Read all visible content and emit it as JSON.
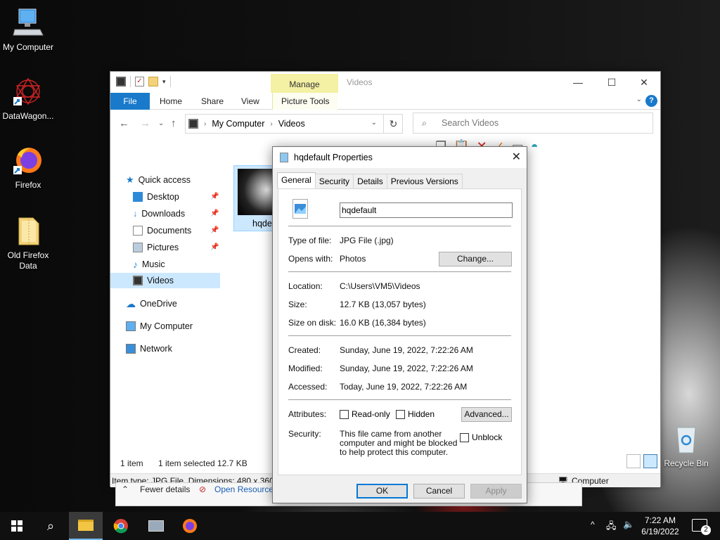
{
  "desktop": {
    "icons": [
      {
        "label": "My Computer"
      },
      {
        "label": "DataWagon..."
      },
      {
        "label": "Firefox"
      },
      {
        "label": "Old Firefox Data"
      },
      {
        "label": "Recycle Bin"
      }
    ]
  },
  "explorer": {
    "title": "Videos",
    "manage_tab": "Manage",
    "ribbon_tabs": [
      "File",
      "Home",
      "Share",
      "View",
      "Picture Tools"
    ],
    "address": {
      "root": "My Computer",
      "current": "Videos"
    },
    "search_placeholder": "Search Videos",
    "nav": {
      "quick_access": "Quick access",
      "items": [
        "Desktop",
        "Downloads",
        "Documents",
        "Pictures",
        "Music",
        "Videos"
      ],
      "onedrive": "OneDrive",
      "my_computer": "My Computer",
      "network": "Network"
    },
    "file_item": {
      "name": "hqdef"
    },
    "status": {
      "count": "1 item",
      "selected": "1 item selected",
      "size": "12.7 KB"
    },
    "details_bar": "Item type: JPG File, Dimensions: 480 x 360, S",
    "computer_label": "Computer",
    "behind": {
      "fewer": "Fewer details",
      "open": "Open Resource"
    }
  },
  "dialog": {
    "title": "hqdefault Properties",
    "tabs": [
      "General",
      "Security",
      "Details",
      "Previous Versions"
    ],
    "filename": "hqdefault",
    "type_label": "Type of file:",
    "type_value": "JPG File (.jpg)",
    "opens_label": "Opens with:",
    "opens_value": "Photos",
    "change_btn": "Change...",
    "location_label": "Location:",
    "location_value": "C:\\Users\\VM5\\Videos",
    "size_label": "Size:",
    "size_value": "12.7 KB (13,057 bytes)",
    "disk_label": "Size on disk:",
    "disk_value": "16.0 KB (16,384 bytes)",
    "created_label": "Created:",
    "created_value": "Sunday, June 19, 2022, 7:22:26 AM",
    "modified_label": "Modified:",
    "modified_value": "Sunday, June 19, 2022, 7:22:26 AM",
    "accessed_label": "Accessed:",
    "accessed_value": "Today, June 19, 2022, 7:22:26 AM",
    "attributes_label": "Attributes:",
    "readonly": "Read-only",
    "hidden": "Hidden",
    "advanced_btn": "Advanced...",
    "security_label": "Security:",
    "security_text": "This file came from another computer and might be blocked to help protect this computer.",
    "unblock": "Unblock",
    "ok": "OK",
    "cancel": "Cancel",
    "apply": "Apply"
  },
  "taskbar": {
    "time": "7:22 AM",
    "date": "6/19/2022",
    "notifications": "2"
  },
  "colors": {
    "accent": "#1979ca",
    "selection": "#cce8ff",
    "manage": "#f4f0a4"
  }
}
